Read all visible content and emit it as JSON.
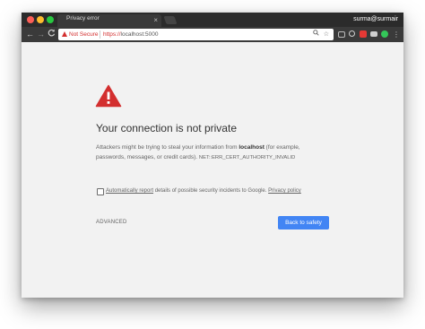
{
  "browser": {
    "tab_title": "Privacy error",
    "tab_close": "×",
    "profile_name": "surma@surmair"
  },
  "toolbar": {
    "back_glyph": "←",
    "forward_glyph": "→",
    "reload_glyph": "C",
    "security_label": "Not Secure",
    "url_scheme": "https://",
    "url_host": "localhost:5000",
    "search_glyph": "⚲",
    "star_glyph": "☆"
  },
  "icons": {
    "warning": "warning-triangle-icon",
    "extensions": [
      "cast-icon",
      "vpn-icon",
      "adblock-icon",
      "screenshot-icon",
      "extension-icon"
    ]
  },
  "colors": {
    "danger": "#d32f2f",
    "primary": "#4285f4",
    "background": "#f2f2f2"
  },
  "page": {
    "heading": "Your connection is not private",
    "description_prefix": "Attackers might be trying to steal your information from ",
    "description_host": "localhost",
    "description_suffix": " (for example, passwords, messages, or credit cards).",
    "error_code": "NET::ERR_CERT_AUTHORITY_INVALID",
    "report_link": "Automatically report",
    "report_middle": " details of possible security incidents to Google. ",
    "privacy_link": "Privacy policy",
    "advanced_label": "ADVANCED",
    "back_to_safety_label": "Back to safety"
  }
}
